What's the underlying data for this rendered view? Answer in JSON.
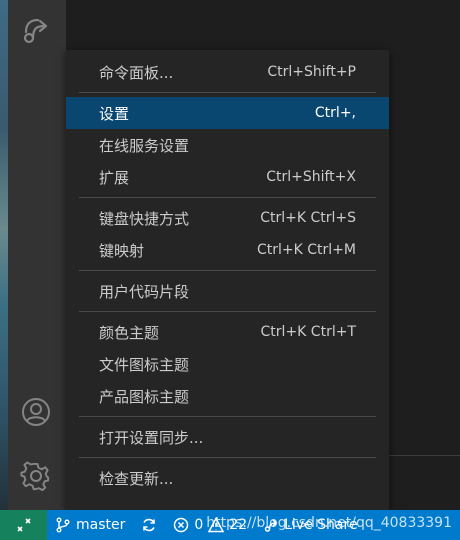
{
  "activity_bar": {
    "icons": [
      "live-share-icon",
      "account-icon",
      "gear-icon"
    ]
  },
  "menu": {
    "groups": [
      [
        {
          "label": "命令面板...",
          "shortcut": "Ctrl+Shift+P",
          "active": false
        }
      ],
      [
        {
          "label": "设置",
          "shortcut": "Ctrl+,",
          "active": true
        },
        {
          "label": "在线服务设置",
          "shortcut": "",
          "active": false
        },
        {
          "label": "扩展",
          "shortcut": "Ctrl+Shift+X",
          "active": false
        }
      ],
      [
        {
          "label": "键盘快捷方式",
          "shortcut": "Ctrl+K Ctrl+S",
          "active": false
        },
        {
          "label": "键映射",
          "shortcut": "Ctrl+K Ctrl+M",
          "active": false
        }
      ],
      [
        {
          "label": "用户代码片段",
          "shortcut": "",
          "active": false
        }
      ],
      [
        {
          "label": "颜色主题",
          "shortcut": "Ctrl+K Ctrl+T",
          "active": false
        },
        {
          "label": "文件图标主题",
          "shortcut": "",
          "active": false
        },
        {
          "label": "产品图标主题",
          "shortcut": "",
          "active": false
        }
      ],
      [
        {
          "label": "打开设置同步...",
          "shortcut": "",
          "active": false
        }
      ],
      [
        {
          "label": "检查更新...",
          "shortcut": "",
          "active": false
        }
      ]
    ]
  },
  "status_bar": {
    "branch": "master",
    "errors": "0",
    "warnings": "22",
    "live_share": "Live Share",
    "watermark": "https://blog.csdn.net/qq_40833391"
  },
  "colors": {
    "status_bar": "#007acc",
    "remote_button": "#16825d",
    "menu_bg": "#252526",
    "menu_selected": "#094771"
  }
}
